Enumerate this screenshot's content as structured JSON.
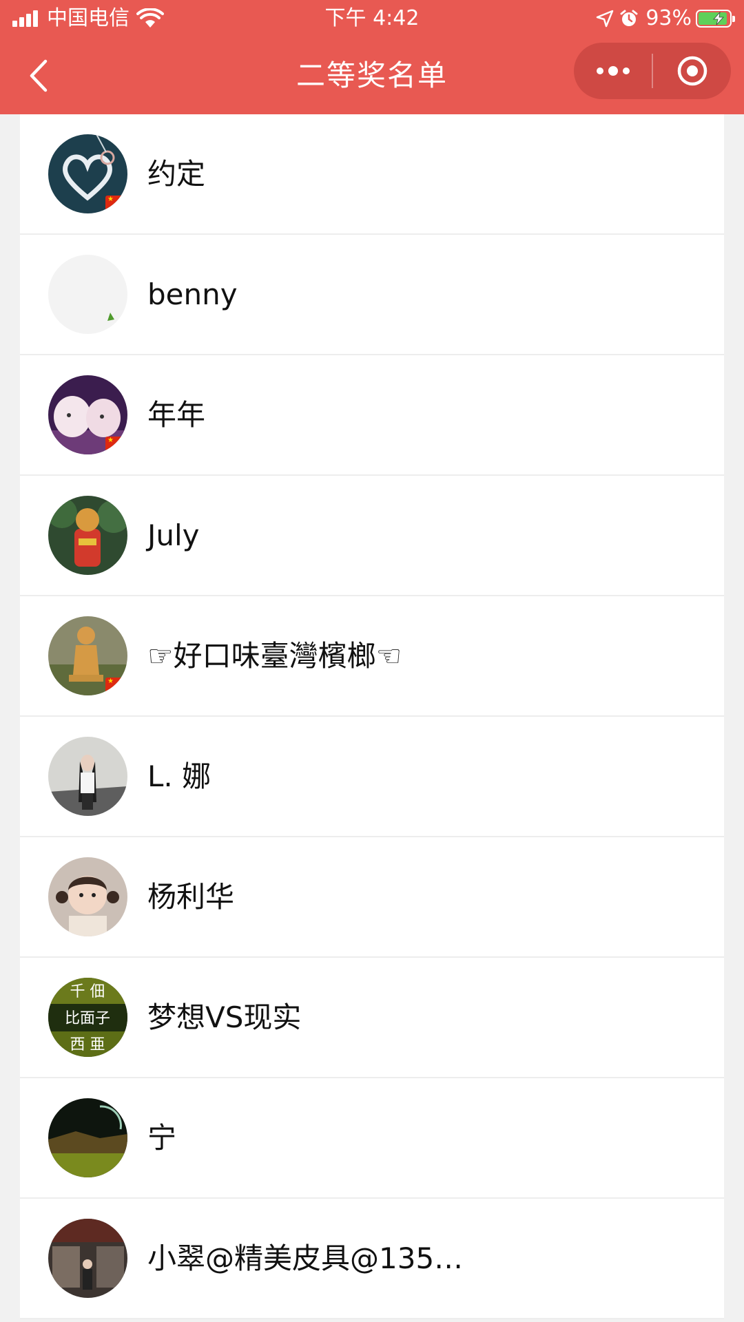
{
  "status_bar": {
    "carrier": "中国电信",
    "time": "下午 4:42",
    "battery_percent": "93%",
    "battery_level": 0.93
  },
  "nav": {
    "title": "二等奖名单"
  },
  "winners": [
    {
      "name": "约定"
    },
    {
      "name": "benny"
    },
    {
      "name": "年年"
    },
    {
      "name": "July"
    },
    {
      "name": "☞好口味臺灣檳榔☜"
    },
    {
      "name": "L. 娜"
    },
    {
      "name": "杨利华"
    },
    {
      "name": "梦想VS现实"
    },
    {
      "name": "宁"
    },
    {
      "name": "小翠@精美皮具@135…"
    }
  ],
  "colors": {
    "header": "#e85952",
    "background": "#f1f1f1",
    "battery_charging": "#5fd05a"
  }
}
